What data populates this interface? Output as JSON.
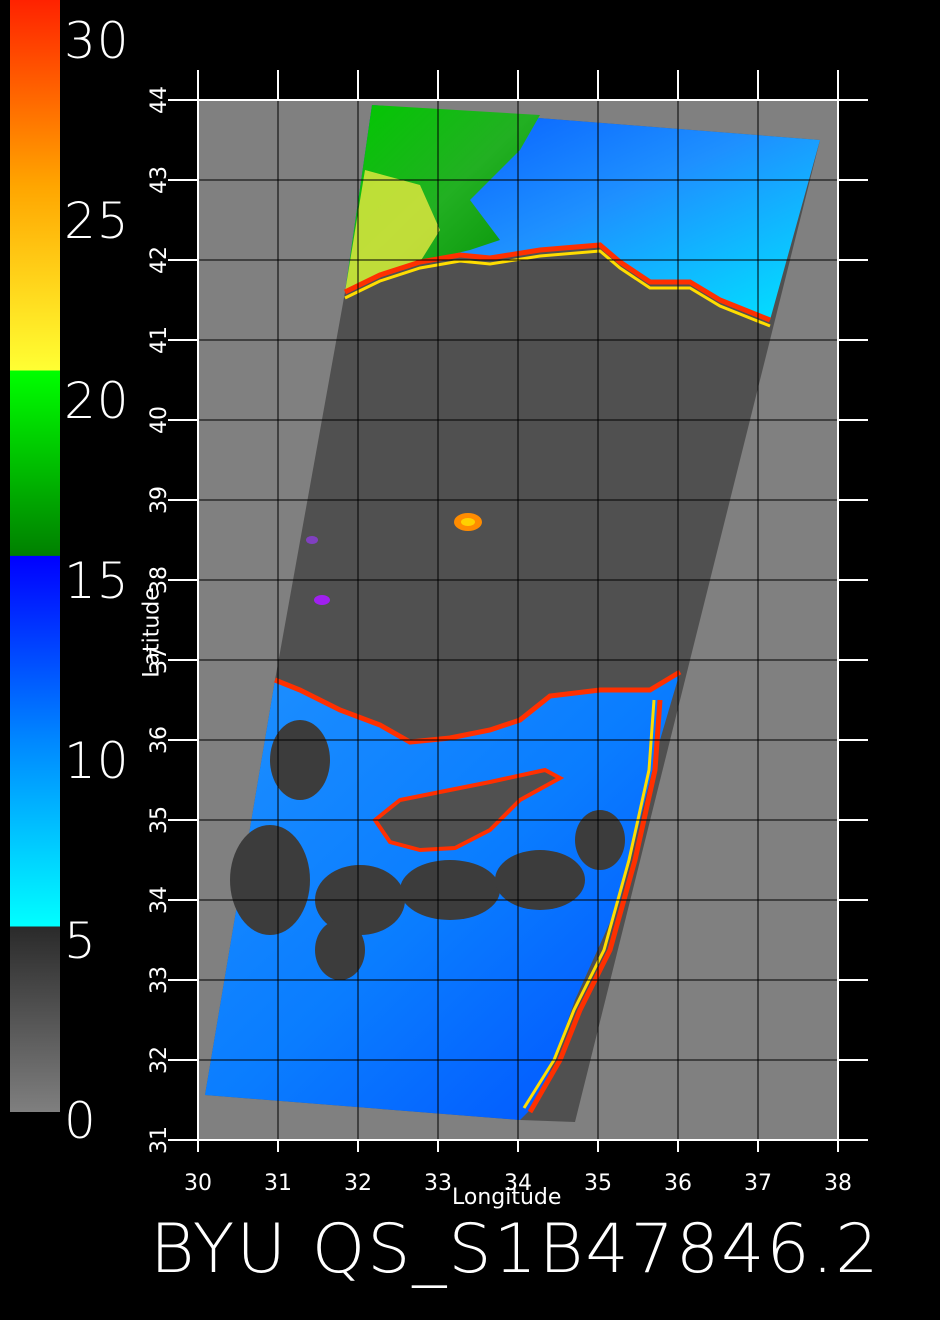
{
  "title": "BYU QS_S1B47846.2",
  "colorbar": {
    "labels": [
      "30",
      "25",
      "20",
      "15",
      "10",
      "5",
      "0"
    ],
    "stops": [
      {
        "value": 0,
        "color": "#7f7f7f"
      },
      {
        "value": 5,
        "color": "#2a2a2a"
      },
      {
        "value": 5.01,
        "color": "#00ffff"
      },
      {
        "value": 10,
        "color": "#0088ff"
      },
      {
        "value": 15,
        "color": "#0000ff"
      },
      {
        "value": 15.01,
        "color": "#008000"
      },
      {
        "value": 20,
        "color": "#00ff00"
      },
      {
        "value": 20.01,
        "color": "#ffff33"
      },
      {
        "value": 25,
        "color": "#ffa500"
      },
      {
        "value": 30,
        "color": "#ff2200"
      }
    ]
  },
  "axes": {
    "xlabel": "Longitude",
    "ylabel": "Latitude",
    "x_ticks": [
      "30",
      "31",
      "32",
      "33",
      "34",
      "35",
      "36",
      "37",
      "38"
    ],
    "y_ticks": [
      "31",
      "32",
      "33",
      "34",
      "35",
      "36",
      "37",
      "38",
      "39",
      "40",
      "41",
      "42",
      "43",
      "44"
    ],
    "xlim": [
      30,
      38
    ],
    "ylim": [
      31,
      44
    ]
  },
  "colors": {
    "background": "#000000",
    "plot_bg": "#808080",
    "land": "#505050",
    "grid": "#000000",
    "text": "#ffffff"
  }
}
